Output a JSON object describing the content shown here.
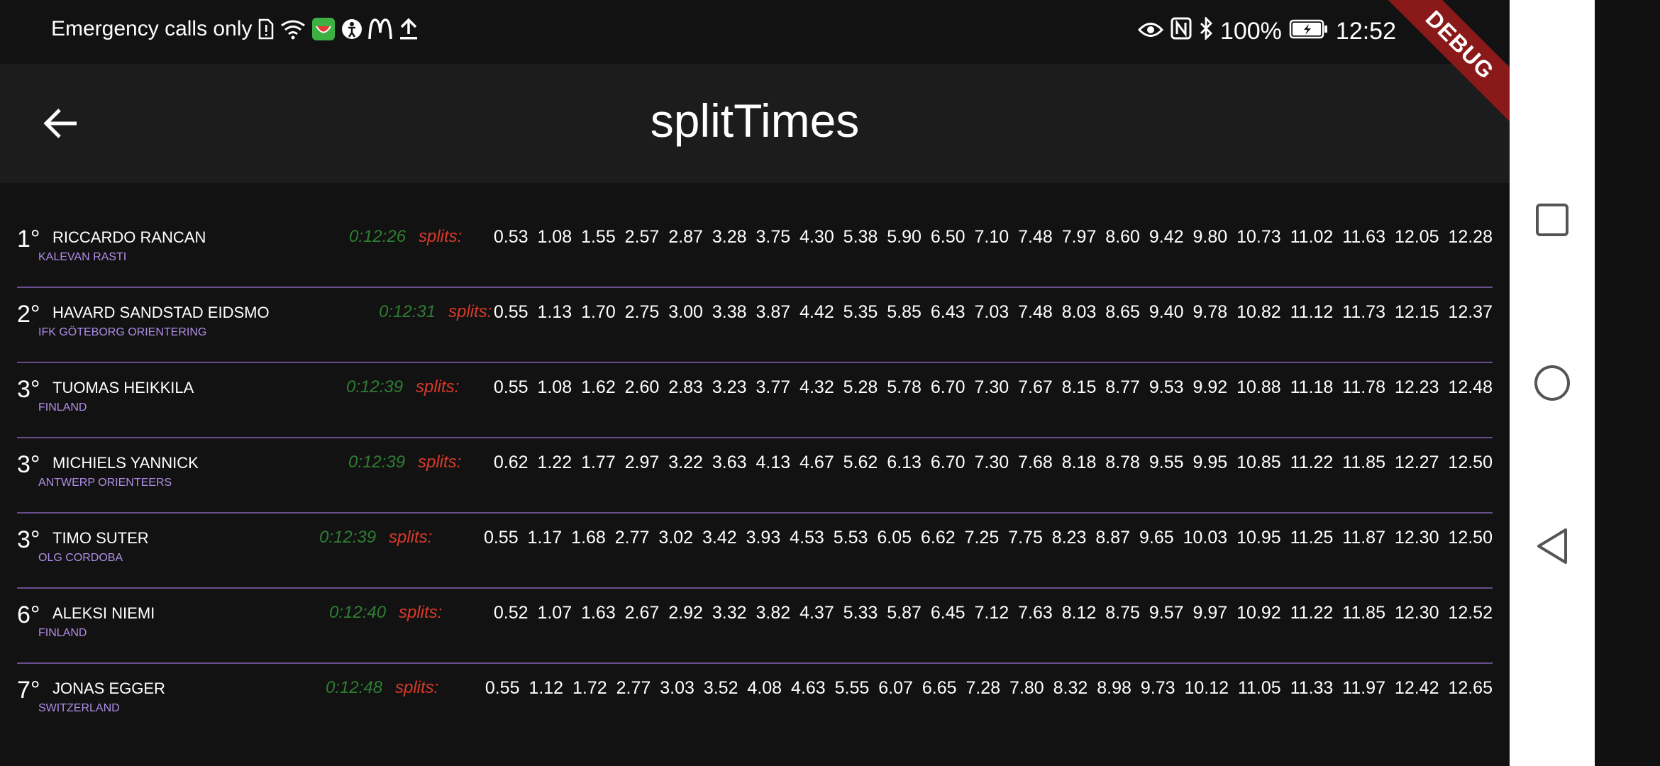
{
  "status_bar": {
    "left_text": "Emergency calls only",
    "battery": "100%",
    "time": "12:52",
    "icons_left": [
      "sim-alert-icon",
      "wifi-icon",
      "app-melon-icon",
      "app-accessibility-icon",
      "mcdonalds-icon",
      "upload-icon"
    ],
    "icons_right": [
      "eye-icon",
      "nfc-icon",
      "bluetooth-icon",
      "battery-charging-icon"
    ]
  },
  "app_bar": {
    "title": "splitTimes"
  },
  "debug_banner": {
    "label": "DEBUG"
  },
  "splits_label": "splits:",
  "results": [
    {
      "rank": "1°",
      "name": "RICCARDO RANCAN",
      "club": "KALEVAN RASTI",
      "time": "0:12:26",
      "splits": "0.53 1.08 1.55 2.57 2.87 3.28 3.75 4.30 5.38 5.90 6.50 7.10 7.48 7.97 8.60 9.42 9.80 10.73 11.02 11.63 12.05 12.28"
    },
    {
      "rank": "2°",
      "name": "HAVARD SANDSTAD EIDSMO",
      "club": "IFK GÖTEBORG ORIENTERING",
      "time": "0:12:31",
      "splits": "0.55 1.13 1.70 2.75 3.00 3.38 3.87 4.42 5.35 5.85 6.43 7.03 7.48 8.03 8.65 9.40 9.78 10.82 11.12 11.73 12.15 12.37"
    },
    {
      "rank": "3°",
      "name": "TUOMAS HEIKKILA",
      "club": "FINLAND",
      "time": "0:12:39",
      "splits": "0.55 1.08 1.62 2.60 2.83 3.23 3.77 4.32 5.28 5.78 6.70 7.30 7.67 8.15 8.77 9.53 9.92 10.88 11.18 11.78 12.23 12.48"
    },
    {
      "rank": "3°",
      "name": "MICHIELS YANNICK",
      "club": "ANTWERP ORIENTEERS",
      "time": "0:12:39",
      "splits": "0.62 1.22 1.77 2.97 3.22 3.63 4.13 4.67 5.62 6.13 6.70 7.30 7.68 8.18 8.78 9.55 9.95 10.85 11.22 11.85 12.27 12.50"
    },
    {
      "rank": "3°",
      "name": "TIMO SUTER",
      "club": "OLG CORDOBA",
      "time": "0:12:39",
      "splits": "0.55 1.17 1.68 2.77 3.02 3.42 3.93 4.53 5.53 6.05 6.62 7.25 7.75 8.23 8.87 9.65 10.03 10.95 11.25 11.87 12.30 12.50"
    },
    {
      "rank": "6°",
      "name": "ALEKSI NIEMI",
      "club": "FINLAND",
      "time": "0:12:40",
      "splits": "0.52 1.07 1.63 2.67 2.92 3.32 3.82 4.37 5.33 5.87 6.45 7.12 7.63 8.12 8.75 9.57 9.97 10.92 11.22 11.85 12.30 12.52"
    },
    {
      "rank": "7°",
      "name": "JONAS EGGER",
      "club": "SWITZERLAND",
      "time": "0:12:48",
      "splits": "0.55 1.12 1.72 2.77 3.03 3.52 4.08 4.63 5.55 6.07 6.65 7.28 7.80 8.32 8.98 9.73 10.12 11.05 11.33 11.97 12.42 12.65"
    }
  ],
  "colors": {
    "time": "#2e7d32",
    "splits_label": "#d83a2a",
    "club": "#b08ee8",
    "divider": "#6a4d8f"
  }
}
